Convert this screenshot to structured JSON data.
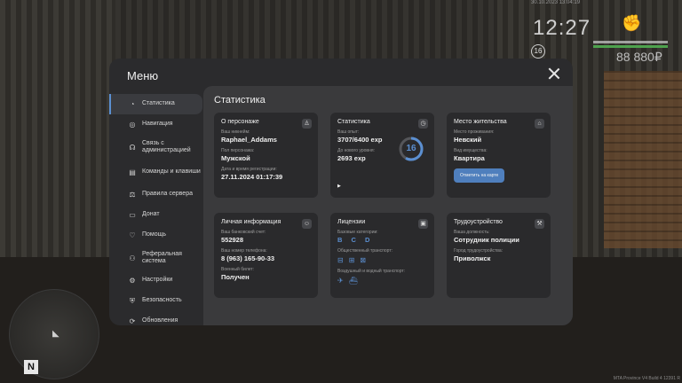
{
  "hud": {
    "date": "30.10.2023 13:04:19",
    "time": "12:27",
    "level": "16",
    "money": "88 880₽"
  },
  "minimap": {
    "north": "N"
  },
  "build": "MTA Province V4 Build 4 12391 R",
  "menu": {
    "title": "Меню",
    "sidebar": [
      {
        "label": "Статистика",
        "icon": "pie-chart-icon"
      },
      {
        "label": "Навигация",
        "icon": "compass-icon"
      },
      {
        "label": "Связь с администрацией",
        "icon": "headset-icon"
      },
      {
        "label": "Команды и клавиши",
        "icon": "keyboard-icon"
      },
      {
        "label": "Правила сервера",
        "icon": "scales-icon"
      },
      {
        "label": "Донат",
        "icon": "wallet-icon"
      },
      {
        "label": "Помощь",
        "icon": "heart-hand-icon"
      },
      {
        "label": "Реферальная система",
        "icon": "people-icon"
      },
      {
        "label": "Настройки",
        "icon": "gear-icon"
      },
      {
        "label": "Безопасность",
        "icon": "shield-icon"
      },
      {
        "label": "Обновления",
        "icon": "refresh-icon"
      }
    ],
    "content": {
      "title": "Статистика",
      "about": {
        "title": "О персонаже",
        "nickname_label": "Ваш никнейм:",
        "nickname": "Raphael_Addams",
        "gender_label": "Пол персонажа:",
        "gender": "Мужской",
        "reg_label": "Дата и время регистрации:",
        "reg": "27.11.2024 01:17:39"
      },
      "stats": {
        "title": "Статистика",
        "exp_label": "Ваш опыт:",
        "exp": "3707/6400 exp",
        "next_label": "До нового уровня:",
        "next": "2693 exp",
        "level": "16",
        "progress": 0.58
      },
      "residence": {
        "title": "Место жительства",
        "place_label": "Место проживания:",
        "place": "Невский",
        "type_label": "Вид имущества:",
        "type": "Квартира",
        "button": "Отметить на карте"
      },
      "personal": {
        "title": "Личная информация",
        "bank_label": "Ваш банковский счет:",
        "bank": "552928",
        "phone_label": "Ваш номер телефона:",
        "phone": "8 (963) 165-90-33",
        "ticket_label": "Военный билет:",
        "ticket": "Получен"
      },
      "licenses": {
        "title": "Лицензии",
        "basic_label": "Базовые категории:",
        "basic": "B C D",
        "public_label": "Общественный транспорт:",
        "air_label": "Воздушный и водный транспорт:"
      },
      "employment": {
        "title": "Трудоустройство",
        "position_label": "Ваша должность:",
        "position": "Сотрудник полиции",
        "city_label": "Город трудоустройства:",
        "city": "Приволжск"
      }
    }
  },
  "colors": {
    "accent": "#5b8fd1",
    "panel": "#2b2b2d",
    "card": "#2a2a2c",
    "content": "#3a3a3c"
  }
}
